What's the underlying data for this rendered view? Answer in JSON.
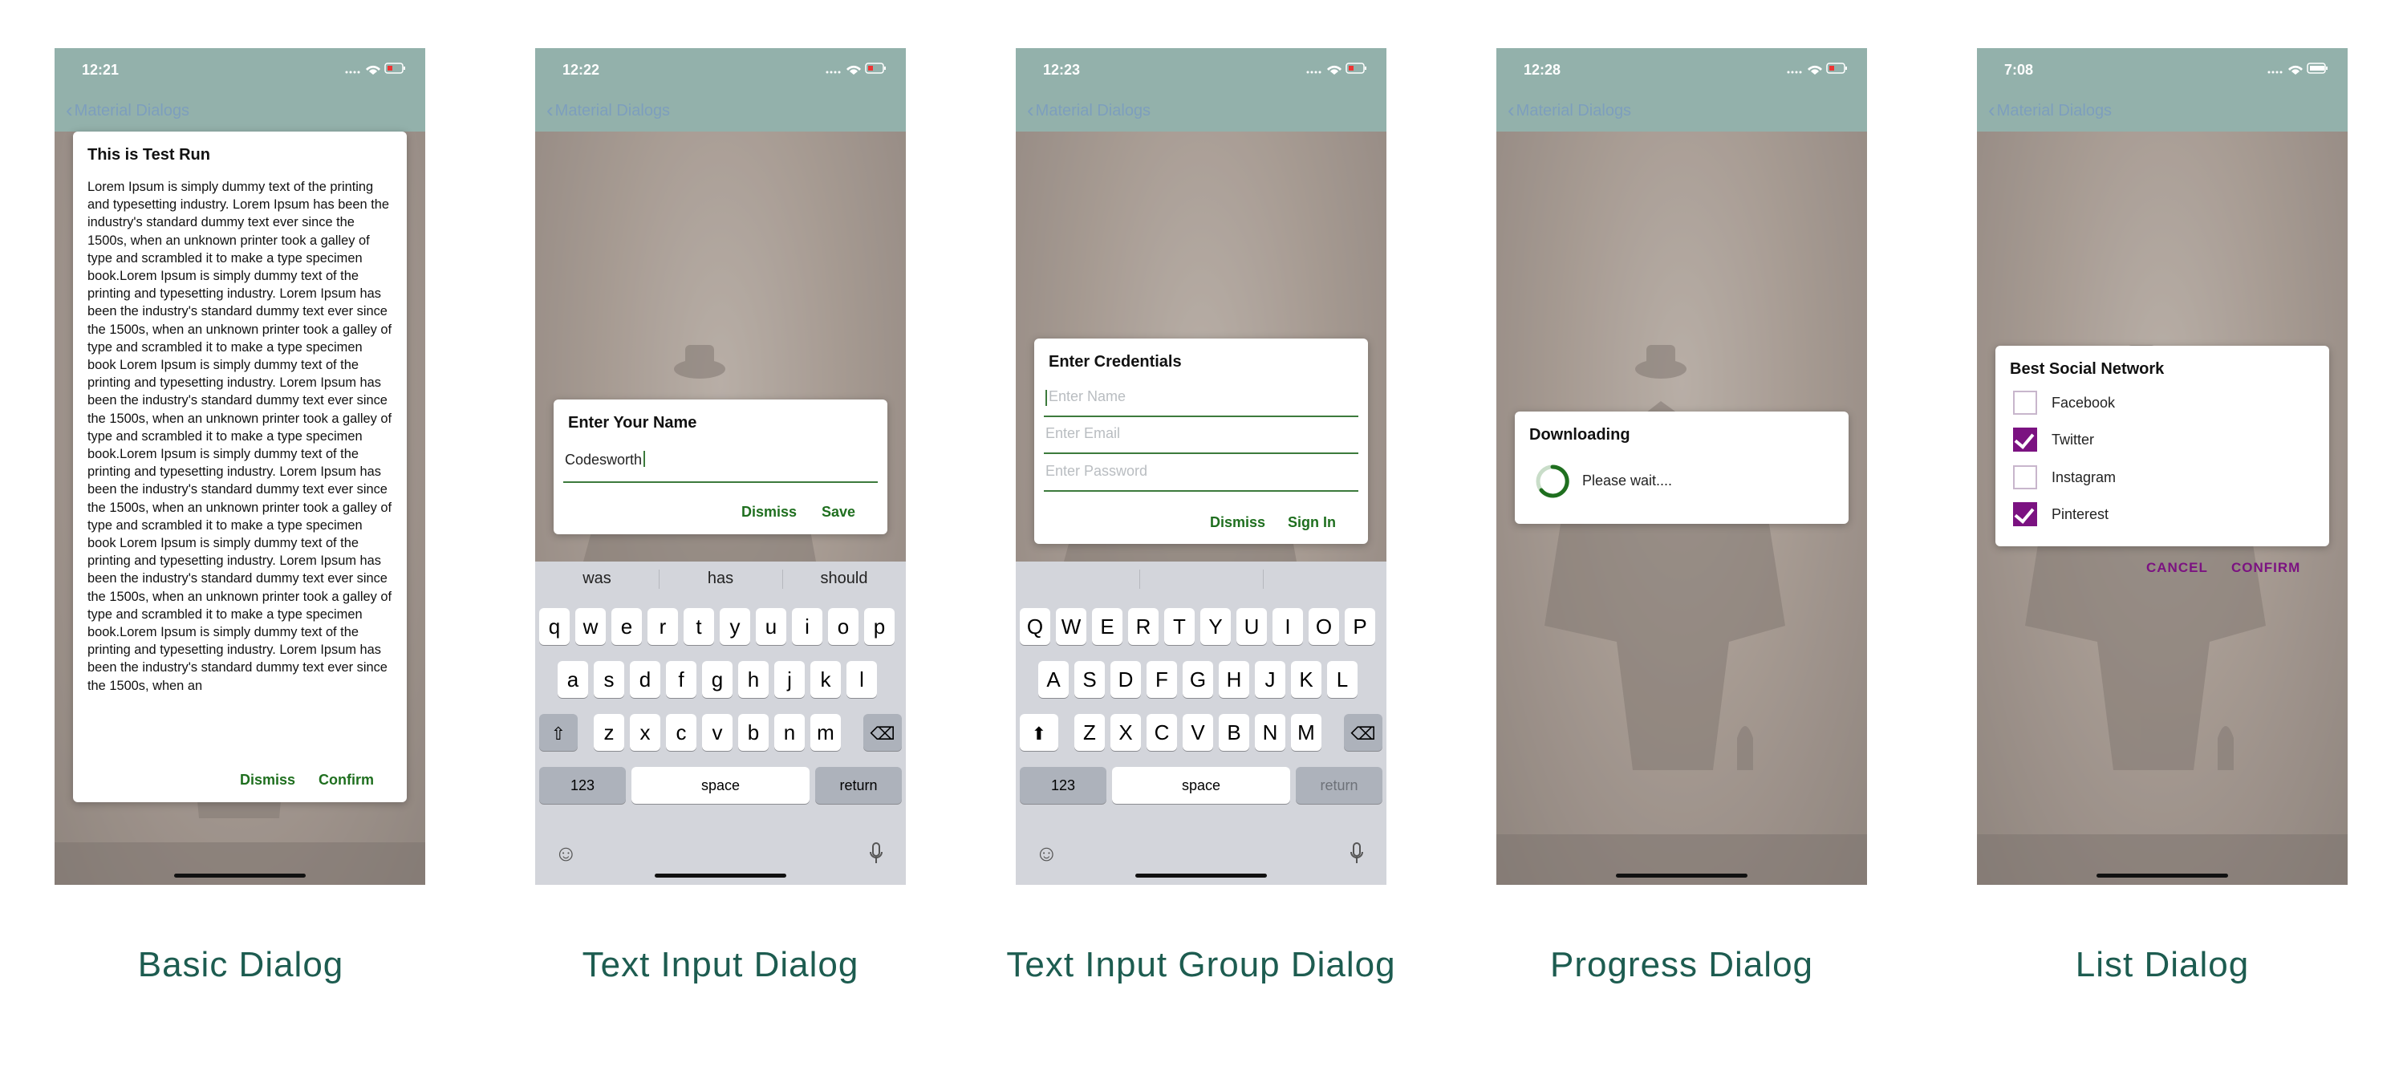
{
  "screens": [
    {
      "time": "12:21",
      "back_label": "Material Dialogs",
      "caption": "Basic Dialog",
      "dialog": {
        "title": "This is Test Run",
        "body": "Lorem Ipsum is simply dummy text of the printing and typesetting industry. Lorem Ipsum has been the industry's standard dummy text ever since the 1500s, when an unknown printer took a galley of type and scrambled it to make a type specimen book.Lorem Ipsum is simply dummy text of the printing and typesetting industry. Lorem Ipsum has been the industry's standard dummy text ever since the 1500s, when an unknown printer took a galley of type and scrambled it to make a type specimen book Lorem Ipsum is simply dummy text of the printing and typesetting industry. Lorem Ipsum has been the industry's standard dummy text ever since the 1500s, when an unknown printer took a galley of type and scrambled it to make a type specimen book.Lorem Ipsum is simply dummy text of the printing and typesetting industry. Lorem Ipsum has been the industry's standard dummy text ever since the 1500s, when an unknown printer took a galley of type and scrambled it to make a type specimen book Lorem Ipsum is simply dummy text of the printing and typesetting industry. Lorem Ipsum has been the industry's standard dummy text ever since the 1500s, when an unknown printer took a galley of type and scrambled it to make a type specimen book.Lorem Ipsum is simply dummy text of the printing and typesetting industry. Lorem Ipsum has been the industry's standard dummy text ever since the 1500s, when an",
        "dismiss": "Dismiss",
        "confirm": "Confirm"
      }
    },
    {
      "time": "12:22",
      "back_label": "Material Dialogs",
      "caption": "Text Input Dialog",
      "dialog": {
        "title": "Enter Your Name",
        "value": "Codesworth",
        "dismiss": "Dismiss",
        "save": "Save"
      },
      "keyboard": {
        "suggestions": [
          "was",
          "has",
          "should"
        ],
        "row1": [
          "q",
          "w",
          "e",
          "r",
          "t",
          "y",
          "u",
          "i",
          "o",
          "p"
        ],
        "row2": [
          "a",
          "s",
          "d",
          "f",
          "g",
          "h",
          "j",
          "k",
          "l"
        ],
        "row3": [
          "z",
          "x",
          "c",
          "v",
          "b",
          "n",
          "m"
        ],
        "numbers_key": "123",
        "space_key": "space",
        "return_key": "return"
      }
    },
    {
      "time": "12:23",
      "back_label": "Material Dialogs",
      "caption": "Text Input Group Dialog",
      "dialog": {
        "title": "Enter Credentials",
        "name_placeholder": "Enter Name",
        "email_placeholder": "Enter Email",
        "password_placeholder": "Enter Password",
        "dismiss": "Dismiss",
        "signin": "Sign In"
      },
      "keyboard": {
        "row1": [
          "Q",
          "W",
          "E",
          "R",
          "T",
          "Y",
          "U",
          "I",
          "O",
          "P"
        ],
        "row2": [
          "A",
          "S",
          "D",
          "F",
          "G",
          "H",
          "J",
          "K",
          "L"
        ],
        "row3": [
          "Z",
          "X",
          "C",
          "V",
          "B",
          "N",
          "M"
        ],
        "numbers_key": "123",
        "space_key": "space",
        "return_key": "return"
      }
    },
    {
      "time": "12:28",
      "back_label": "Material Dialogs",
      "caption": "Progress Dialog",
      "dialog": {
        "title": "Downloading",
        "message": "Please wait...."
      }
    },
    {
      "time": "7:08",
      "back_label": "Material Dialogs",
      "caption": "List Dialog",
      "dialog": {
        "title": "Best Social Network",
        "items": [
          {
            "label": "Facebook",
            "checked": false
          },
          {
            "label": "Twitter",
            "checked": true
          },
          {
            "label": "Instagram",
            "checked": false
          },
          {
            "label": "Pinterest",
            "checked": true
          }
        ],
        "cancel": "CANCEL",
        "confirm": "CONFIRM"
      }
    }
  ],
  "colors": {
    "header": "#93b1ab",
    "accent_green": "#1f6f1f",
    "accent_purple": "#7b1281",
    "caption": "#1d5c50"
  }
}
